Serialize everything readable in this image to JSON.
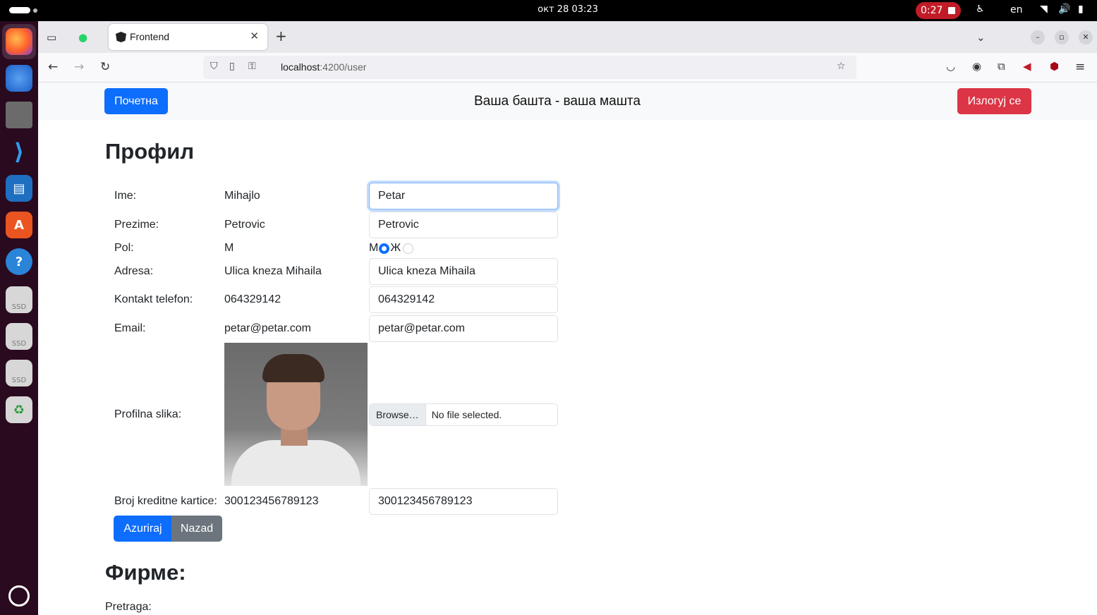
{
  "system": {
    "clock": "окт 28  03:23",
    "recording": "0:27",
    "language": "en"
  },
  "browser": {
    "tab_title": "Frontend",
    "url_host": "localhost",
    "url_path": ":4200/user"
  },
  "header": {
    "home_button": "Почетна",
    "site_title": "Ваша башта - ваша машта",
    "logout_button": "Излогуј се"
  },
  "profile": {
    "heading": "Профил",
    "fields": {
      "first_name": {
        "label": "Ime:",
        "value": "Mihajlo",
        "input": "Petar"
      },
      "last_name": {
        "label": "Prezime:",
        "value": "Petrovic",
        "input": "Petrovic"
      },
      "gender": {
        "label": "Pol:",
        "value": "M",
        "option_m": "M",
        "option_f": "Ж"
      },
      "address": {
        "label": "Adresa:",
        "value": "Ulica kneza Mihaila",
        "input": "Ulica kneza Mihaila"
      },
      "phone": {
        "label": "Kontakt telefon:",
        "value": "064329142",
        "input": "064329142"
      },
      "email": {
        "label": "Email:",
        "value": "petar@petar.com",
        "input": "petar@petar.com"
      },
      "photo": {
        "label": "Profilna slika:",
        "browse": "Browse…",
        "no_file": "No file selected."
      },
      "card": {
        "label": "Broj kreditne kartice:",
        "value": "300123456789123",
        "input": "300123456789123"
      }
    },
    "update_button": "Azuriraj",
    "back_button": "Nazad"
  },
  "firms": {
    "heading": "Фирме:",
    "search_label": "Pretraga:"
  },
  "colors": {
    "primary": "#0d6efd",
    "danger": "#dc3545",
    "secondary": "#6c757d"
  }
}
